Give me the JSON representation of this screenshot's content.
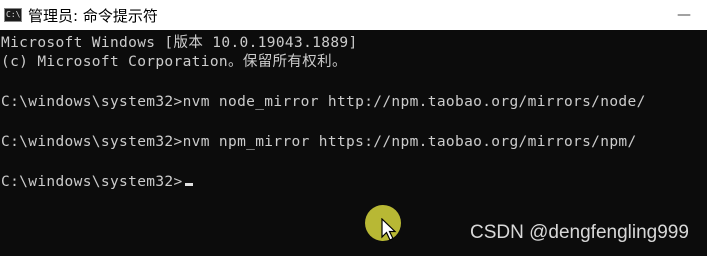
{
  "window": {
    "title": "管理员: 命令提示符",
    "icon_text": "C:\\",
    "icon": "cmd-icon",
    "minimize_label": "—"
  },
  "console": {
    "lines": [
      "Microsoft Windows [版本 10.0.19043.1889]",
      "(c) Microsoft Corporation。保留所有权利。",
      "C:\\windows\\system32>nvm node_mirror http://npm.taobao.org/mirrors/node/",
      "C:\\windows\\system32>nvm npm_mirror https://npm.taobao.org/mirrors/npm/",
      "C:\\windows\\system32>"
    ]
  },
  "watermark": "CSDN @dengfengling999",
  "colors": {
    "console_bg": "#0c0c0c",
    "console_text": "#cccccc",
    "highlight": "#d7d73c"
  }
}
